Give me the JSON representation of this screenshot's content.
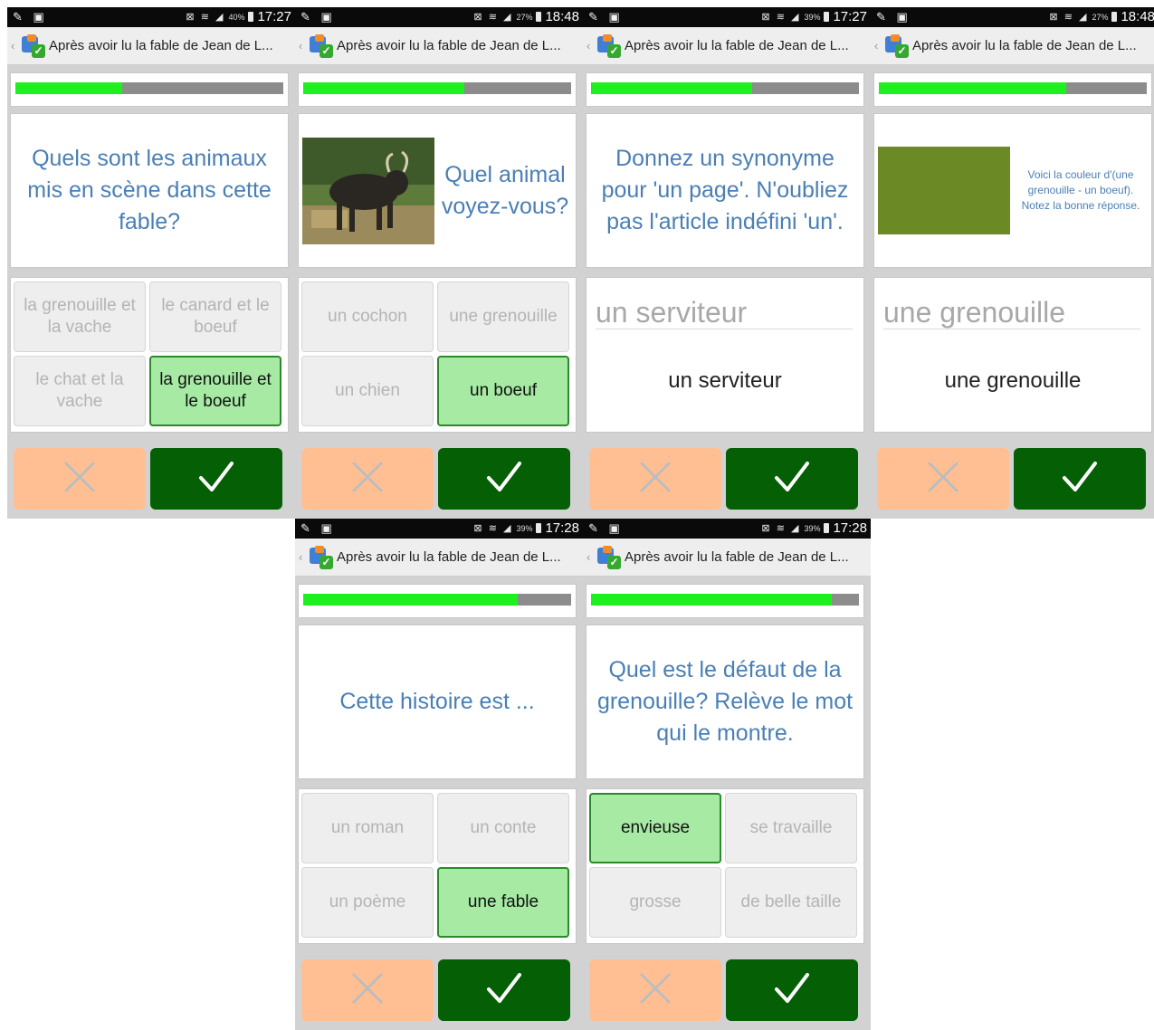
{
  "app_title": "Après avoir lu la fable de Jean de L...",
  "screens": [
    {
      "status": {
        "time": "17:27",
        "battery": "40%"
      },
      "progress": 0.4,
      "question": "Quels sont les animaux mis en scène dans cette fable?",
      "options": [
        "la grenouille et la vache",
        "le canard et le boeuf",
        "le chat et la vache",
        "la grenouille et le boeuf"
      ],
      "selected_option": 3
    },
    {
      "status": {
        "time": "18:48",
        "battery": "27%"
      },
      "progress": 0.6,
      "image": "bull-photo",
      "question": "Quel animal voyez-vous?",
      "options": [
        "un cochon",
        "une grenouille",
        "un chien",
        "un boeuf"
      ],
      "selected_option": 3
    },
    {
      "status": {
        "time": "17:27",
        "battery": "39%"
      },
      "progress": 0.6,
      "question": "Donnez un synonyme pour 'un page'. N'oubliez pas l'article indéfini 'un'.",
      "input_value": "un serviteur",
      "answer": "un serviteur"
    },
    {
      "status": {
        "time": "18:48",
        "battery": "27%"
      },
      "progress": 0.7,
      "color_swatch": "#6b8a26",
      "question": "Voici la couleur d'(une grenouille - un boeuf). Notez la bonne réponse.",
      "input_value": "une grenouille",
      "answer": "une grenouille"
    },
    {
      "status": {
        "time": "17:28",
        "battery": "39%"
      },
      "progress": 0.8,
      "question": "Cette histoire est ...",
      "options": [
        "un roman",
        "un conte",
        "un poème",
        "une fable"
      ],
      "selected_option": 3
    },
    {
      "status": {
        "time": "17:28",
        "battery": "39%"
      },
      "progress": 0.9,
      "question": "Quel est le défaut de la grenouille? Relève le mot qui le montre.",
      "options": [
        "envieuse",
        "se travaille",
        "grosse",
        "de belle taille"
      ],
      "selected_option": 0
    }
  ],
  "buttons": {
    "reject_icon": "cross-icon",
    "accept_icon": "check-icon"
  },
  "colors": {
    "progress_fill": "#1ef01e",
    "question_text": "#4a7fb5",
    "reject_button": "#ffbf93",
    "accept_button": "#056005",
    "selected_option": "#a6eaa4"
  }
}
